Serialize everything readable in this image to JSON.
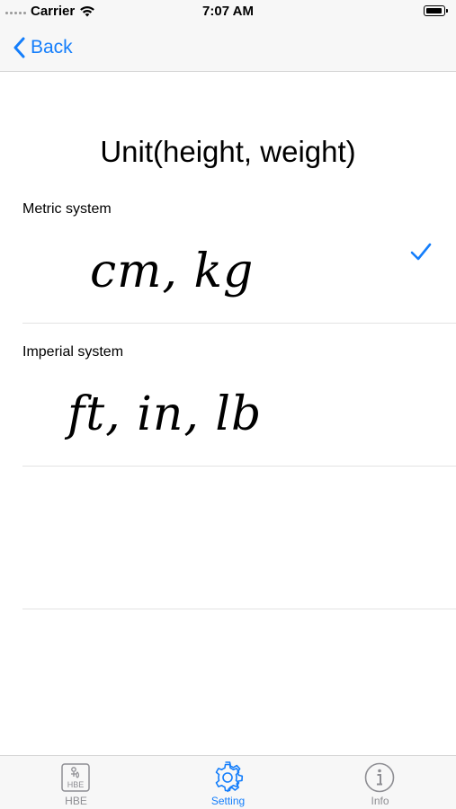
{
  "status_bar": {
    "carrier": "Carrier",
    "time": "7:07 AM"
  },
  "nav": {
    "back_label": "Back"
  },
  "section": {
    "title": "Unit(height, weight)"
  },
  "options": [
    {
      "label": "Metric system",
      "value": "cm, kg",
      "selected": true
    },
    {
      "label": "Imperial system",
      "value": "ft, in, lb",
      "selected": false
    }
  ],
  "tabs": [
    {
      "label": "HBE",
      "icon": "hbe-logo-icon",
      "active": false
    },
    {
      "label": "Setting",
      "icon": "gear-icon",
      "active": true
    },
    {
      "label": "Info",
      "icon": "info-icon",
      "active": false
    }
  ],
  "colors": {
    "accent": "#147efb",
    "inactive": "#8e8e93",
    "bar_background": "#f7f7f7"
  }
}
